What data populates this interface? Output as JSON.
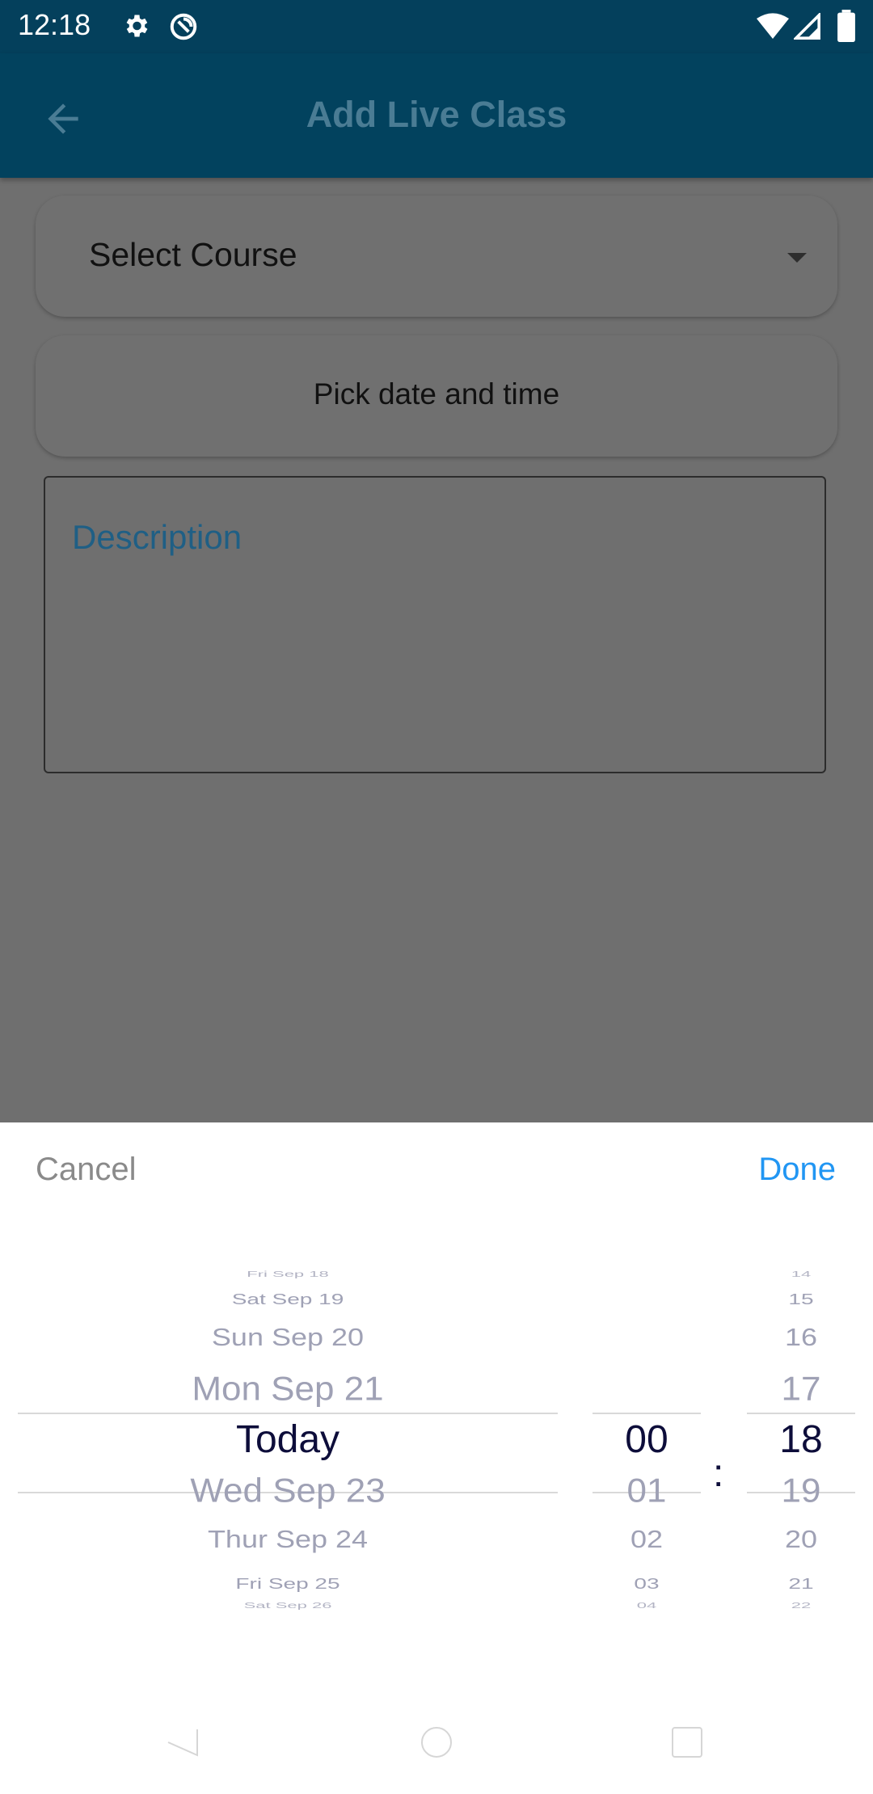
{
  "status_bar": {
    "time": "12:18",
    "icons": [
      "gear-icon",
      "vpn-icon",
      "wifi-icon",
      "signal-icon",
      "battery-icon"
    ]
  },
  "app_bar": {
    "title": "Add Live Class",
    "back_icon": "arrow-back-icon"
  },
  "form": {
    "course_select_value": "Select Course",
    "date_button_label": "Pick date and time",
    "description_placeholder": "Description"
  },
  "picker": {
    "cancel_label": "Cancel",
    "done_label": "Done",
    "date_column": [
      "Fri Sep 18",
      "Sat Sep 19",
      "Sun Sep 20",
      "Mon Sep 21",
      "Today",
      "Wed Sep 23",
      "Thur Sep 24",
      "Fri Sep 25",
      "Sat Sep 26"
    ],
    "hour_column": [
      "",
      "",
      "",
      "",
      "00",
      "01",
      "02",
      "03",
      "04"
    ],
    "minute_column": [
      "14",
      "15",
      "16",
      "17",
      "18",
      "19",
      "20",
      "21",
      "22"
    ],
    "separator": ":",
    "selected": {
      "date": "Today",
      "hour": "00",
      "minute": "18"
    }
  },
  "colors": {
    "primary": "#02425e",
    "accent": "#2196f3",
    "selected_text": "#0d0d3a",
    "dim_text": "#9fa1b5"
  }
}
